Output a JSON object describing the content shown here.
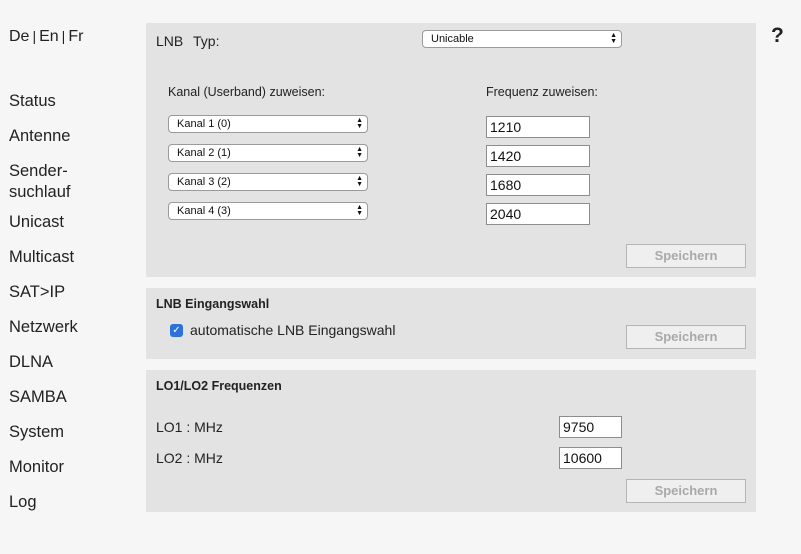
{
  "lang": {
    "de": "De",
    "en": "En",
    "fr": "Fr",
    "sep": "|"
  },
  "help_label": "?",
  "nav": [
    {
      "label": "Status"
    },
    {
      "label": "Antenne"
    },
    {
      "label": "Sender-"
    },
    {
      "label": "suchlauf"
    },
    {
      "label": "Unicast"
    },
    {
      "label": "Multicast"
    },
    {
      "label": "SAT>IP"
    },
    {
      "label": "Netzwerk"
    },
    {
      "label": "DLNA"
    },
    {
      "label": "SAMBA"
    },
    {
      "label": "System"
    },
    {
      "label": "Monitor"
    },
    {
      "label": "Log"
    }
  ],
  "lnb": {
    "title": "LNB",
    "typ_label": "Typ:",
    "typ_value": "Unicable",
    "kanal_header": "Kanal (Userband) zuweisen:",
    "freq_header": "Frequenz zuweisen:",
    "channels": [
      {
        "kanal": "Kanal 1 (0)",
        "freq": "1210"
      },
      {
        "kanal": "Kanal 2 (1)",
        "freq": "1420"
      },
      {
        "kanal": "Kanal 3 (2)",
        "freq": "1680"
      },
      {
        "kanal": "Kanal 4 (3)",
        "freq": "2040"
      }
    ],
    "save": "Speichern"
  },
  "eingang": {
    "title": "LNB Eingangswahl",
    "checkbox_label": "automatische LNB Eingangswahl",
    "checked": true,
    "save": "Speichern"
  },
  "lo": {
    "title": "LO1/LO2 Frequenzen",
    "lo1_label": "LO1 : MHz",
    "lo1_value": "9750",
    "lo2_label": "LO2 : MHz",
    "lo2_value": "10600",
    "save": "Speichern"
  },
  "icons": {
    "select_arrows": "updown-arrows-icon",
    "checkmark": "checkmark-icon"
  },
  "colors": {
    "panel": "#e3e3e3",
    "checkbox": "#2d72d9",
    "disabled_text": "#a9a9a9"
  }
}
